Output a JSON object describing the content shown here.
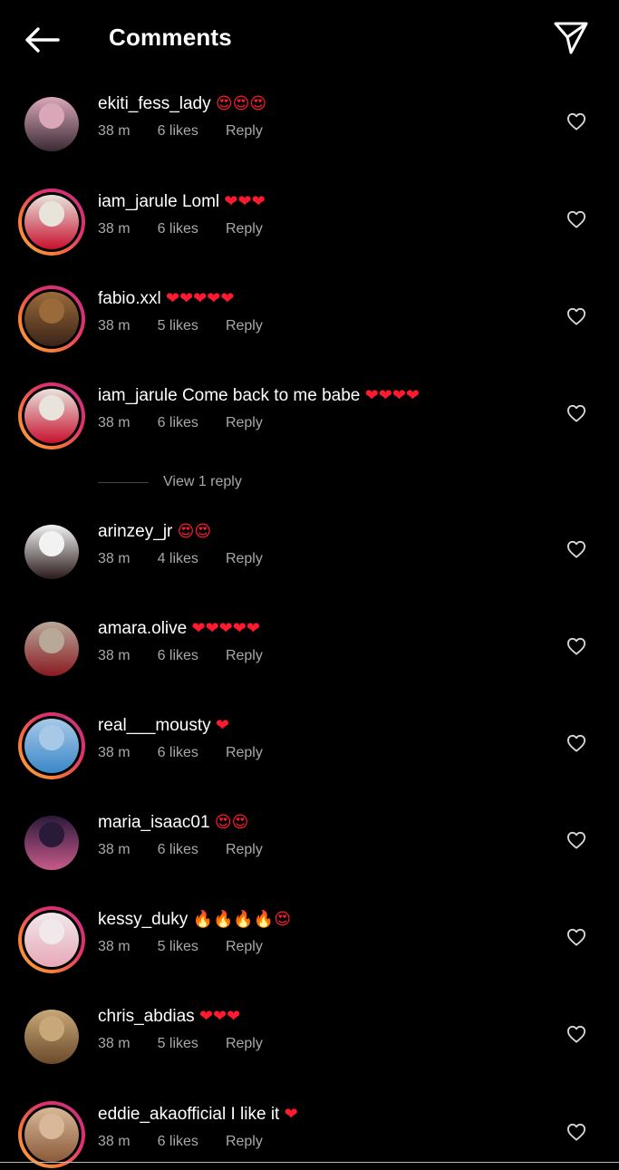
{
  "header": {
    "title": "Comments",
    "back_icon": "arrow-left-icon",
    "send_icon": "paper-plane-icon"
  },
  "colors": {
    "background": "#000000",
    "meta_text": "#a8a8a8",
    "heart": "#ff1a2f",
    "story_ring": "#e1306c"
  },
  "view_replies_label": "View 1 reply",
  "comments": [
    {
      "username": "ekiti_fess_lady",
      "text": "",
      "emojis": "😍😍😍",
      "time": "38 m",
      "likes": "6 likes",
      "reply": "Reply",
      "ring": false,
      "avatar_colors": [
        "#d9a7b8",
        "#3a2a35"
      ]
    },
    {
      "username": "iam_jarule",
      "text": "Loml",
      "emojis": "❤❤❤",
      "time": "38 m",
      "likes": "6 likes",
      "reply": "Reply",
      "ring": true,
      "avatar_colors": [
        "#e8e4dc",
        "#c8102e"
      ]
    },
    {
      "username": "fabio.xxl",
      "text": "",
      "emojis": "❤❤❤❤❤",
      "time": "38 m",
      "likes": "5 likes",
      "reply": "Reply",
      "ring": true,
      "avatar_colors": [
        "#9a6a3a",
        "#3a2418"
      ]
    },
    {
      "username": "iam_jarule",
      "text": "Come back to me babe",
      "emojis": "❤❤❤❤",
      "time": "38 m",
      "likes": "6 likes",
      "reply": "Reply",
      "ring": true,
      "avatar_colors": [
        "#e8e4dc",
        "#c8102e"
      ]
    },
    {
      "username": "arinzey_jr",
      "text": "",
      "emojis": "😍😍",
      "time": "38 m",
      "likes": "4 likes",
      "reply": "Reply",
      "ring": false,
      "avatar_colors": [
        "#f2f2f2",
        "#2a1a1a"
      ]
    },
    {
      "username": "amara.olive",
      "text": "",
      "emojis": "❤❤❤❤❤",
      "time": "38 m",
      "likes": "6 likes",
      "reply": "Reply",
      "ring": false,
      "avatar_colors": [
        "#b8a898",
        "#8a1a22"
      ]
    },
    {
      "username": "real___mousty",
      "text": "",
      "emojis": "❤",
      "time": "38 m",
      "likes": "6 likes",
      "reply": "Reply",
      "ring": true,
      "avatar_colors": [
        "#a8c8e8",
        "#3a88c8"
      ]
    },
    {
      "username": "maria_isaac01",
      "text": "",
      "emojis": "😍😍",
      "time": "38 m",
      "likes": "6 likes",
      "reply": "Reply",
      "ring": false,
      "avatar_colors": [
        "#2a1a3a",
        "#c85a8a"
      ]
    },
    {
      "username": "kessy_duky",
      "text": "",
      "emojis": "🔥🔥🔥🔥😍",
      "time": "38 m",
      "likes": "5 likes",
      "reply": "Reply",
      "ring": true,
      "avatar_colors": [
        "#f0e8ea",
        "#e8a8b8"
      ]
    },
    {
      "username": "chris_abdias",
      "text": "",
      "emojis": "❤❤❤",
      "time": "38 m",
      "likes": "5 likes",
      "reply": "Reply",
      "ring": false,
      "avatar_colors": [
        "#c8a878",
        "#6a4a2a"
      ]
    },
    {
      "username": "eddie_akaofficial",
      "text": "I like it",
      "emojis": "❤",
      "time": "38 m",
      "likes": "6 likes",
      "reply": "Reply",
      "ring": true,
      "avatar_colors": [
        "#d8b898",
        "#8a5a3a"
      ]
    }
  ]
}
